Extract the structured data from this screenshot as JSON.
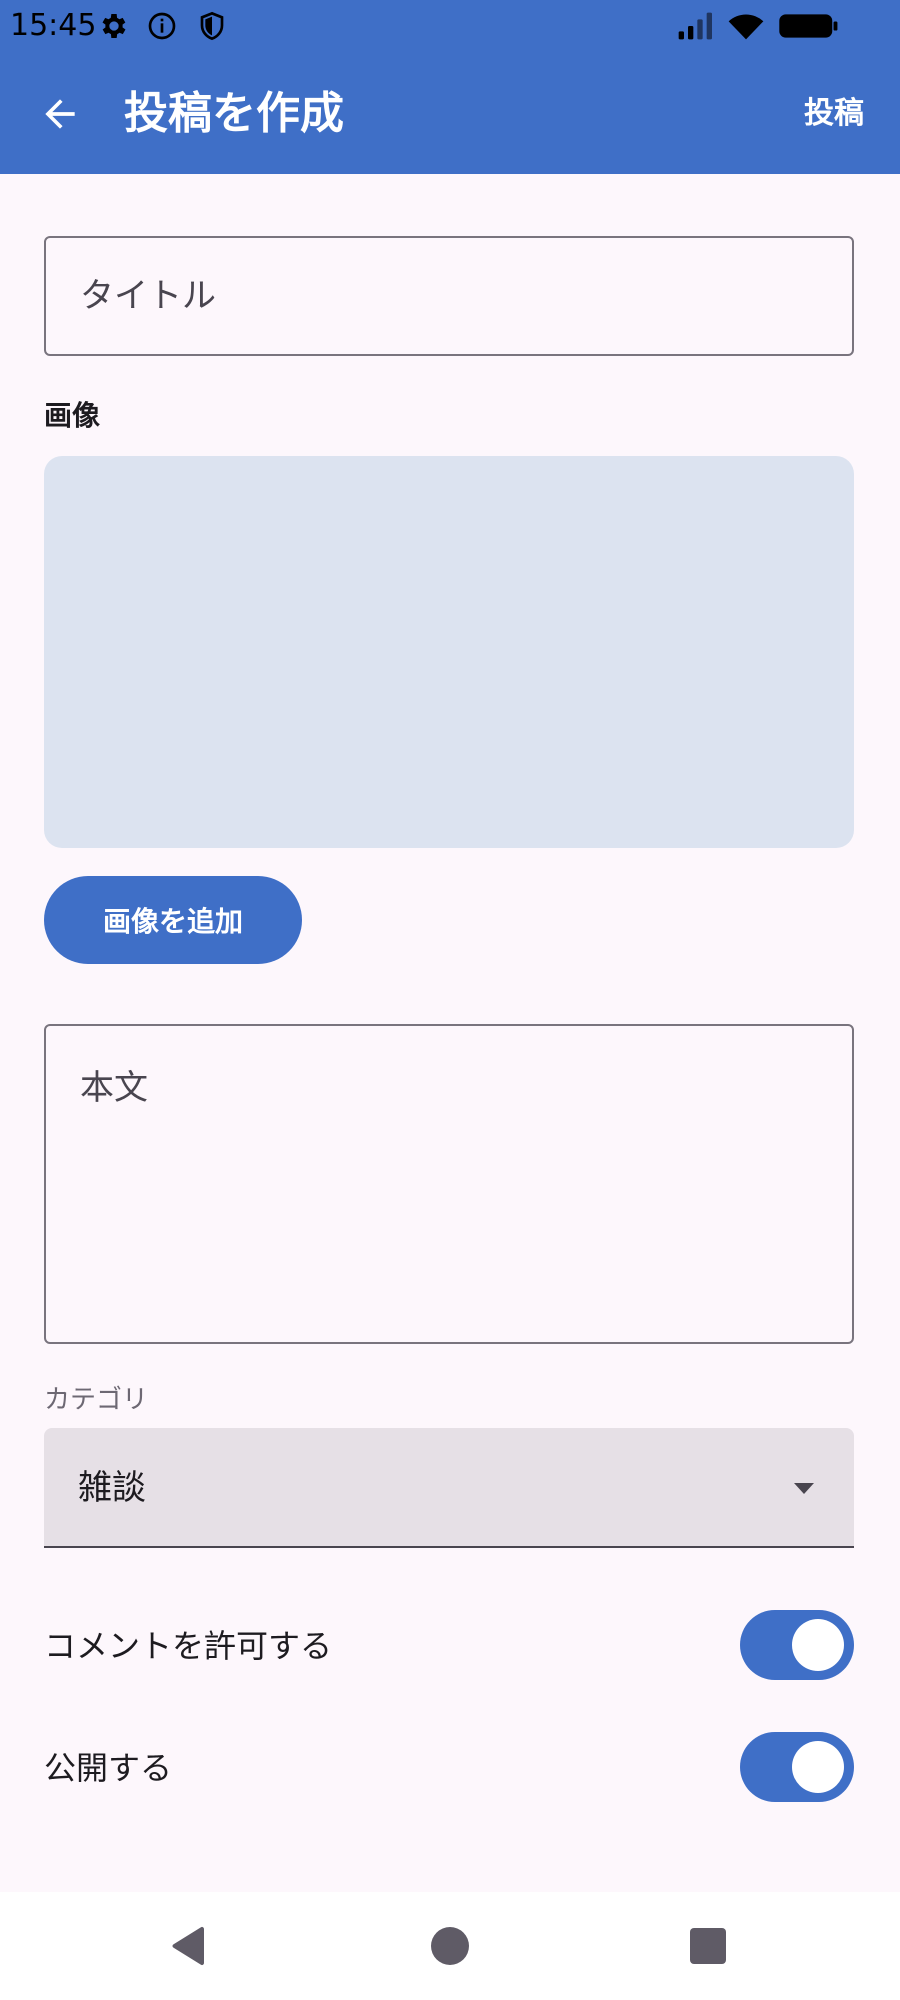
{
  "status_bar": {
    "time": "15:45",
    "icons": [
      "gear-icon",
      "info-icon",
      "shield-icon",
      "signal-icon",
      "wifi-icon",
      "battery-icon"
    ]
  },
  "app_bar": {
    "title": "投稿を作成",
    "action_label": "投稿",
    "back_icon": "arrow-back-icon"
  },
  "form": {
    "title_placeholder": "タイトル",
    "image_label": "画像",
    "add_image_label": "画像を追加",
    "body_placeholder": "本文",
    "category_label": "カテゴリ",
    "category_value": "雑談",
    "switches": [
      {
        "label": "コメントを許可する",
        "checked": true
      },
      {
        "label": "公開する",
        "checked": true
      }
    ]
  },
  "nav_bar": {
    "icons": [
      "back-triangle-icon",
      "home-circle-icon",
      "recents-square-icon"
    ]
  },
  "colors": {
    "primary": "#3f6fc7",
    "background": "#fdf7fc",
    "image_area": "#dce3f0",
    "select_fill": "#e6e0e6"
  }
}
